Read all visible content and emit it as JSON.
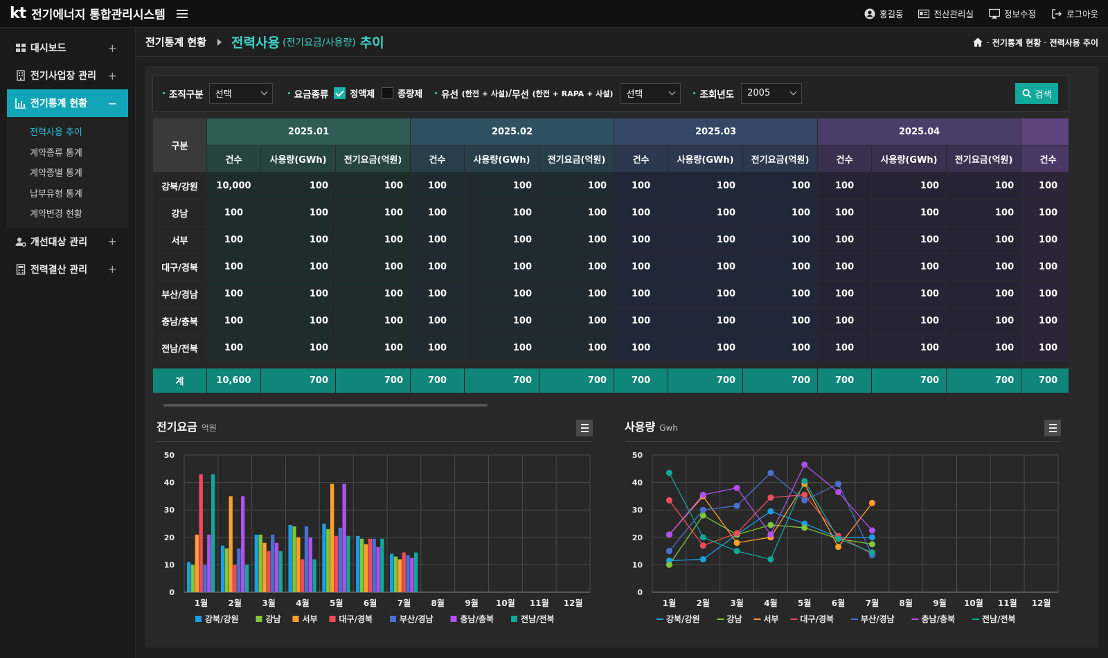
{
  "app": {
    "logo": "kt",
    "title": "전기에너지 통합관리시스템"
  },
  "topnav": {
    "user": "홍길동",
    "admin": "전산관리실",
    "edit_profile": "정보수정",
    "logout": "로그아웃"
  },
  "sidebar": {
    "items": [
      {
        "label": "대시보드",
        "toggle": "+"
      },
      {
        "label": "전기사업장 관리",
        "toggle": "+"
      },
      {
        "label": "전기통계 현황",
        "toggle": "−"
      },
      {
        "label": "개선대상 관리",
        "toggle": "+"
      },
      {
        "label": "전력결산 관리",
        "toggle": "+"
      }
    ],
    "submenu": [
      "전력사용 추이",
      "계약종류 통계",
      "계약종별 통계",
      "납부유형 통계",
      "계약변경 현황"
    ]
  },
  "header": {
    "parent": "전기통계 현황",
    "title_main": "전력사용",
    "title_sub": "(전기요금/사용량)",
    "title_end": "추이",
    "path_parent": "전기통계 현황",
    "path_current": "전력사용 추이",
    "path_sep": "-"
  },
  "filter": {
    "org_label": "조직구분",
    "org_value": "선택",
    "rate_label": "요금종류",
    "opt_flat": "정액제",
    "opt_flat_checked": true,
    "opt_meter": "종량제",
    "opt_meter_checked": false,
    "wired_label": "유선",
    "wired_note": "(한전 + 사설)",
    "wireless_label": "무선",
    "wireless_note": "(한전 + RAPA + 사설)",
    "slash": "/",
    "wired_value": "선택",
    "year_label": "조회년도",
    "year_value": "2005",
    "search_label": "검색"
  },
  "table": {
    "gubun": "구분",
    "months": [
      {
        "label": "2025.01",
        "color": "#2f5c55",
        "sub": "#26453f",
        "body": "#1e2c2a"
      },
      {
        "label": "2025.02",
        "color": "#2f5262",
        "sub": "#283f4a",
        "body": "#1f2a31"
      },
      {
        "label": "2025.03",
        "color": "#354766",
        "sub": "#2b384f",
        "body": "#202736"
      },
      {
        "label": "2025.04",
        "color": "#4a3d6a",
        "sub": "#3a3150",
        "body": "#262334"
      },
      {
        "label": "",
        "color": "#5f4580",
        "sub": "#4a3866",
        "body": "#2c2538"
      }
    ],
    "subheads": [
      "건수",
      "사용량(GWh)",
      "전기요금(억원)"
    ],
    "rows": [
      {
        "label": "강북/강원",
        "cells": [
          "10,000",
          "100",
          "100",
          "100",
          "100",
          "100",
          "100",
          "100",
          "100",
          "100",
          "100",
          "100",
          "100"
        ]
      },
      {
        "label": "강남",
        "cells": [
          "100",
          "100",
          "100",
          "100",
          "100",
          "100",
          "100",
          "100",
          "100",
          "100",
          "100",
          "100",
          "100"
        ]
      },
      {
        "label": "서부",
        "cells": [
          "100",
          "100",
          "100",
          "100",
          "100",
          "100",
          "100",
          "100",
          "100",
          "100",
          "100",
          "100",
          "100"
        ]
      },
      {
        "label": "대구/경북",
        "cells": [
          "100",
          "100",
          "100",
          "100",
          "100",
          "100",
          "100",
          "100",
          "100",
          "100",
          "100",
          "100",
          "100"
        ]
      },
      {
        "label": "부산/경남",
        "cells": [
          "100",
          "100",
          "100",
          "100",
          "100",
          "100",
          "100",
          "100",
          "100",
          "100",
          "100",
          "100",
          "100"
        ]
      },
      {
        "label": "충남/충북",
        "cells": [
          "100",
          "100",
          "100",
          "100",
          "100",
          "100",
          "100",
          "100",
          "100",
          "100",
          "100",
          "100",
          "100"
        ]
      },
      {
        "label": "전남/전북",
        "cells": [
          "100",
          "100",
          "100",
          "100",
          "100",
          "100",
          "100",
          "100",
          "100",
          "100",
          "100",
          "100",
          "100"
        ]
      }
    ],
    "total": {
      "label": "계",
      "cells": [
        "10,600",
        "700",
        "700",
        "700",
        "700",
        "700",
        "700",
        "700",
        "700",
        "700",
        "700",
        "700",
        "700"
      ]
    }
  },
  "chart_data": [
    {
      "type": "bar",
      "title": "전기요금",
      "unit": "억원",
      "categories": [
        "1월",
        "2월",
        "3월",
        "4월",
        "5월",
        "6월",
        "7월",
        "8월",
        "9월",
        "10월",
        "11월",
        "12월"
      ],
      "ylim": [
        0,
        50
      ],
      "yticks": [
        0,
        10,
        20,
        30,
        40,
        50
      ],
      "grid": true,
      "legend": "bottom",
      "series": [
        {
          "name": "강북/강원",
          "color": "#1a9fe0",
          "values": [
            11,
            17,
            21,
            24.5,
            25,
            20.5,
            14
          ]
        },
        {
          "name": "강남",
          "color": "#7ec63a",
          "values": [
            10,
            16,
            21,
            24,
            23,
            19.5,
            13
          ]
        },
        {
          "name": "서부",
          "color": "#ff9f2e",
          "values": [
            21,
            35,
            18,
            20,
            39.5,
            17.5,
            12
          ]
        },
        {
          "name": "대구/경북",
          "color": "#f04b5a",
          "values": [
            43,
            10,
            15,
            12,
            20.5,
            19.5,
            14.5
          ]
        },
        {
          "name": "부산/경남",
          "color": "#4a6fd0",
          "values": [
            10,
            16,
            21,
            24,
            23.5,
            19.5,
            13.5
          ]
        },
        {
          "name": "충남/충북",
          "color": "#b050f0",
          "values": [
            21,
            35,
            18,
            20,
            39.5,
            16.5,
            12.5
          ]
        },
        {
          "name": "전남/전북",
          "color": "#10a898",
          "values": [
            43,
            10,
            15,
            12,
            20.5,
            19.5,
            14.5
          ]
        }
      ]
    },
    {
      "type": "line",
      "title": "사용량",
      "unit": "Gwh",
      "categories": [
        "1월",
        "2월",
        "3월",
        "4월",
        "5월",
        "6월",
        "7월",
        "8월",
        "9월",
        "10월",
        "11월",
        "12월"
      ],
      "ylim": [
        0,
        50
      ],
      "yticks": [
        0,
        10,
        20,
        30,
        40,
        50
      ],
      "grid": true,
      "legend": "bottom",
      "series": [
        {
          "name": "강북/강원",
          "color": "#1a9fe0",
          "values": [
            11.5,
            12,
            21,
            29.5,
            25,
            20,
            20
          ]
        },
        {
          "name": "강남",
          "color": "#7ec63a",
          "values": [
            10,
            28,
            21,
            24.5,
            23.5,
            19.5,
            17.5
          ]
        },
        {
          "name": "서부",
          "color": "#ff9f2e",
          "values": [
            21,
            35,
            18,
            20,
            39.5,
            16.5,
            32.5
          ]
        },
        {
          "name": "대구/경북",
          "color": "#f04b5a",
          "values": [
            33.5,
            17,
            21.5,
            34.5,
            35.5,
            20.5,
            14
          ]
        },
        {
          "name": "부산/경남",
          "color": "#4a6fd0",
          "values": [
            15,
            30,
            31.5,
            43.5,
            33.5,
            39.5,
            13.5
          ]
        },
        {
          "name": "충남/충북",
          "color": "#b050f0",
          "values": [
            21,
            35.5,
            38,
            21,
            46.5,
            36.5,
            22.5
          ]
        },
        {
          "name": "전남/전북",
          "color": "#10a898",
          "values": [
            43.5,
            20,
            15,
            12,
            40.5,
            19.5,
            14.5
          ]
        }
      ]
    }
  ]
}
